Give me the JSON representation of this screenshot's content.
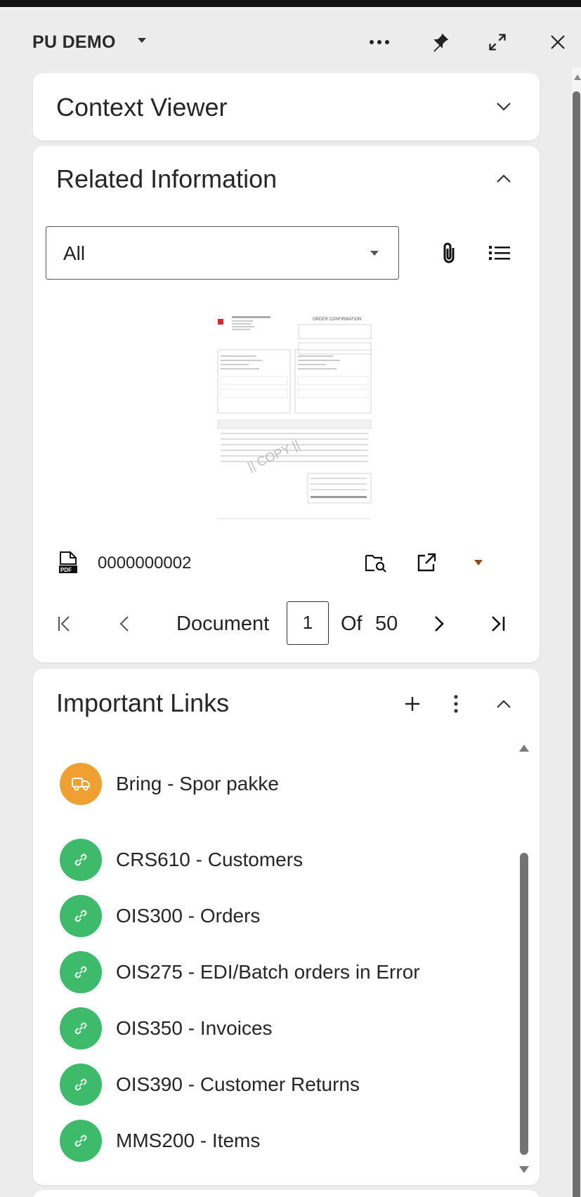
{
  "header": {
    "title": "PU DEMO",
    "icons": [
      "more-horizontal-icon",
      "pin-icon",
      "expand-icon",
      "close-icon"
    ]
  },
  "context_viewer": {
    "title": "Context Viewer"
  },
  "related_information": {
    "title": "Related Information",
    "filter": {
      "selected": "All"
    },
    "document": {
      "file_name": "0000000002",
      "type_icon": "pdf-file-icon",
      "thumbnail_heading": "ORDER CONFIRMATION",
      "thumbnail_watermark": "|| COPY ||"
    },
    "pager": {
      "label": "Document",
      "current": "1",
      "of_label": "Of",
      "total": "50"
    }
  },
  "important_links": {
    "title": "Important Links",
    "items": [
      {
        "label": "Bring - Spor pakke",
        "icon": "truck-icon",
        "color": "#f0a030"
      },
      {
        "label": "CRS610 - Customers",
        "icon": "link-icon",
        "color": "#3dbb6a"
      },
      {
        "label": "OIS300 - Orders",
        "icon": "link-icon",
        "color": "#3dbb6a"
      },
      {
        "label": "OIS275 - EDI/Batch orders in Error",
        "icon": "link-icon",
        "color": "#3dbb6a"
      },
      {
        "label": "OIS350 - Invoices",
        "icon": "link-icon",
        "color": "#3dbb6a"
      },
      {
        "label": "OIS390 - Customer Returns",
        "icon": "link-icon",
        "color": "#3dbb6a"
      },
      {
        "label": "MMS200 - Items",
        "icon": "link-icon",
        "color": "#3dbb6a"
      }
    ]
  },
  "colors": {
    "accent_orange": "#f0a030",
    "link_green": "#3dbb6a",
    "dropdown_arrow_brown": "#8a4a1a"
  }
}
